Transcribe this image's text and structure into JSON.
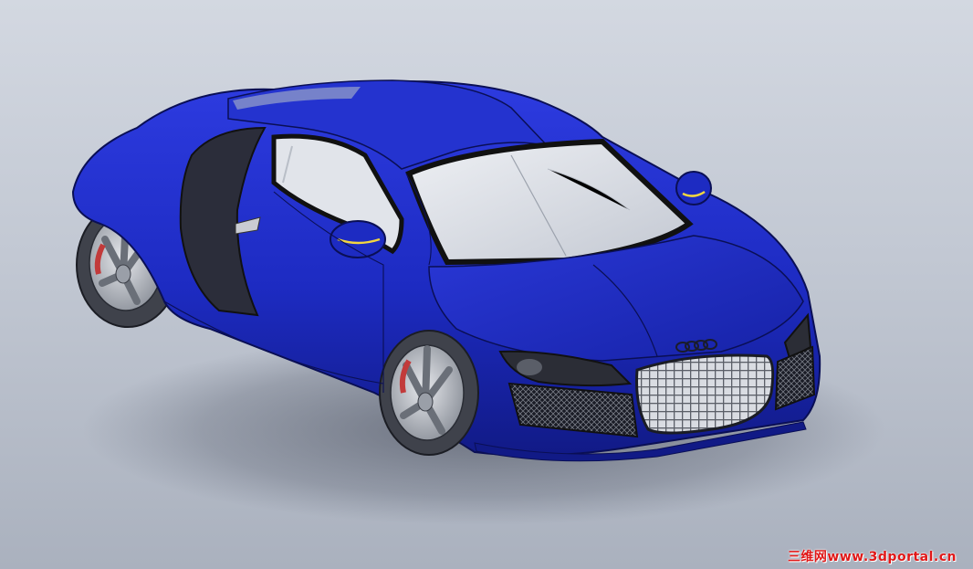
{
  "scene": {
    "model": "car",
    "view": "isometric",
    "background_color": "#c6ccd6",
    "body_color": "#1d2bc2",
    "body_dark_color": "#0e1577",
    "glass_color": "#d6dae2",
    "interior_color": "#e1e4ea",
    "side_blade_color": "#2b2d3a",
    "wheel_color": "#b3b7be",
    "tire_color": "#4a4d55",
    "brake_caliper_color": "#c23a3a",
    "grille_color": "#c8ccd3",
    "indicator_color": "#f2d640"
  },
  "brand": {
    "logo": "four-rings-logo"
  },
  "watermark": {
    "text": "三维网www.3dportal.cn",
    "color": "#e01818"
  }
}
